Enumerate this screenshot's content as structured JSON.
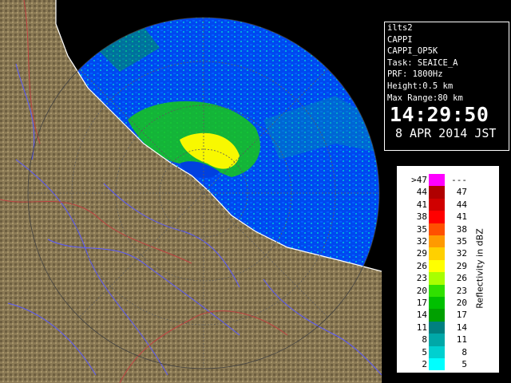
{
  "info": {
    "lines": [
      "ilts2",
      "CAPPI",
      "CAPPI_OP5K",
      "Task: SEAICE_A",
      "PRF: 1800Hz",
      "Height:0.5 km",
      "Max Range:80 km"
    ],
    "time": "14:29:50",
    "date": "8 APR 2014 JST"
  },
  "legend": {
    "unit_label": "Reflectivity in dBZ",
    "rows": [
      {
        "lo": ">47",
        "hi": "---",
        "color": "#ff00ff"
      },
      {
        "lo": "44",
        "hi": "47",
        "color": "#b00000"
      },
      {
        "lo": "41",
        "hi": "44",
        "color": "#d00000"
      },
      {
        "lo": "38",
        "hi": "41",
        "color": "#ff0000"
      },
      {
        "lo": "35",
        "hi": "38",
        "color": "#ff5000"
      },
      {
        "lo": "32",
        "hi": "35",
        "color": "#ff9a00"
      },
      {
        "lo": "29",
        "hi": "32",
        "color": "#ffd000"
      },
      {
        "lo": "26",
        "hi": "29",
        "color": "#ffff00"
      },
      {
        "lo": "23",
        "hi": "26",
        "color": "#a8ff00"
      },
      {
        "lo": "20",
        "hi": "23",
        "color": "#30e000"
      },
      {
        "lo": "17",
        "hi": "20",
        "color": "#00c000"
      },
      {
        "lo": "14",
        "hi": "17",
        "color": "#00a000"
      },
      {
        "lo": "11",
        "hi": "14",
        "color": "#008080"
      },
      {
        "lo": "8",
        "hi": "11",
        "color": "#00a8a8"
      },
      {
        "lo": "5",
        "hi": "8",
        "color": "#00d0d0"
      },
      {
        "lo": "2",
        "hi": "5",
        "color": "#00ffff"
      }
    ]
  },
  "colors": {
    "land": "#8b7a55",
    "sea_echo": "#0050ff",
    "river": "#5a5aff",
    "boundary": "#c04040"
  }
}
